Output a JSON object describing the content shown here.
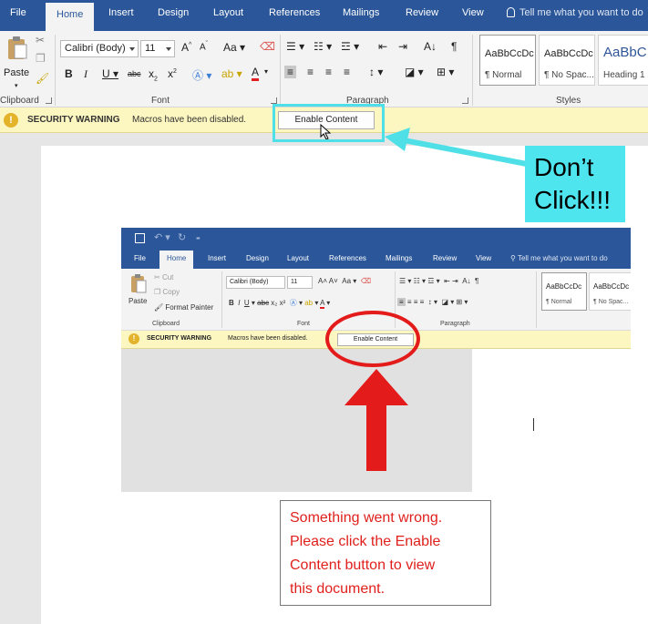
{
  "outer": {
    "tabs": [
      "File",
      "Home",
      "Insert",
      "Design",
      "Layout",
      "References",
      "Mailings",
      "Review",
      "View"
    ],
    "active_tab": "Home",
    "tell_me": "Tell me what you want to do",
    "clipboard": {
      "paste_label": "Paste",
      "group_label": "Clipboard"
    },
    "font": {
      "name": "Calibri (Body)",
      "size": "11",
      "group_label": "Font"
    },
    "paragraph": {
      "group_label": "Paragraph"
    },
    "styles": {
      "group_label": "Styles",
      "items": [
        {
          "preview": "AaBbCcDc",
          "name": "¶ Normal"
        },
        {
          "preview": "AaBbCcDc",
          "name": "¶ No Spac..."
        },
        {
          "preview": "AaBbC",
          "name": "Heading 1"
        }
      ]
    },
    "security_bar": {
      "title": "SECURITY WARNING",
      "message": "Macros have been disabled.",
      "button": "Enable Content"
    }
  },
  "callout": {
    "line1": "Don’t",
    "line2": "Click!!!",
    "color": "#4fe5ee"
  },
  "inner": {
    "tabs": [
      "File",
      "Home",
      "Insert",
      "Design",
      "Layout",
      "References",
      "Mailings",
      "Review",
      "View"
    ],
    "active_tab": "Home",
    "tell_me": "Tell me what you want to do",
    "clipboard": {
      "paste_label": "Paste",
      "cut": "Cut",
      "copy": "Copy",
      "format_painter": "Format Painter",
      "group_label": "Clipboard"
    },
    "font": {
      "name": "Calibri (Body)",
      "size": "11",
      "group_label": "Font"
    },
    "paragraph": {
      "group_label": "Paragraph"
    },
    "styles": [
      {
        "preview": "AaBbCcDc",
        "name": "¶ Normal"
      },
      {
        "preview": "AaBbCcDc",
        "name": "¶ No Spac..."
      }
    ],
    "security_bar": {
      "title": "SECURITY WARNING",
      "message": "Macros have been disabled.",
      "button": "Enable Content"
    }
  },
  "lure": {
    "lines": [
      "Something went wrong.",
      "Please click the Enable",
      "Content button to view",
      "this document."
    ],
    "color": "#e0201c"
  }
}
